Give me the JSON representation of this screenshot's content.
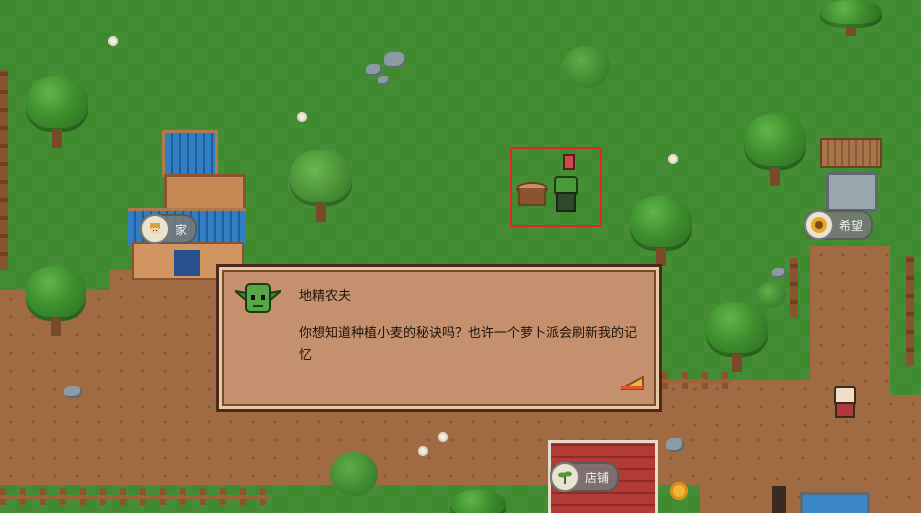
{
  "npc_name": "地精农夫",
  "dialog_text": "你想知道种植小麦的秘诀吗？也许一个萝卜派会刷新我的记忆",
  "signs": {
    "home": "家",
    "wish": "希望",
    "shop": "店铺"
  },
  "icons": {
    "npc_portrait": "goblin-face-icon",
    "reward_item": "pie-slice-icon",
    "home_sign": "villager-portrait-icon",
    "wish_sign": "sunflower-icon",
    "shop_sign": "sprout-icon",
    "quest_marker": "exclamation-icon"
  },
  "colors": {
    "highlight": "#e5251f",
    "dialog_bg": "#c4906e",
    "grass": "#3f8a2f",
    "dirt": "#a06a43"
  }
}
